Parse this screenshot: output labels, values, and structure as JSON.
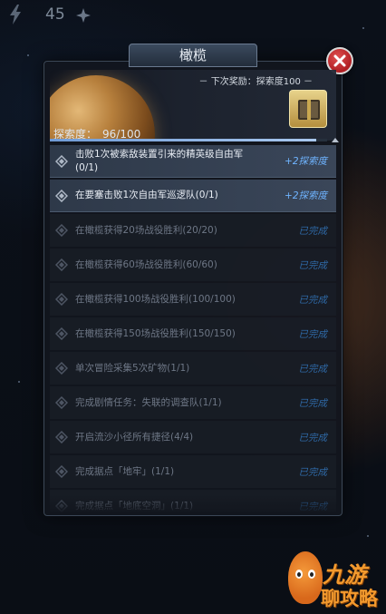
{
  "hud": {
    "count": "45"
  },
  "dialog": {
    "title": "橄榄",
    "reward_label": "－ 下次奖励：探索度100 －",
    "explore_label": "探索度：",
    "explore_value": "96/100",
    "explore_progress": 0.96
  },
  "tasks": [
    {
      "text": "击败1次被索敌装置引来的精英级自由军(0/1)",
      "status": "+2探索度",
      "state": "active"
    },
    {
      "text": "在要塞击败1次自由军巡逻队(0/1)",
      "status": "+2探索度",
      "state": "active"
    },
    {
      "text": "在橄榄获得20场战役胜利(20/20)",
      "status": "已完成",
      "state": "done"
    },
    {
      "text": "在橄榄获得60场战役胜利(60/60)",
      "status": "已完成",
      "state": "done"
    },
    {
      "text": "在橄榄获得100场战役胜利(100/100)",
      "status": "已完成",
      "state": "done"
    },
    {
      "text": "在橄榄获得150场战役胜利(150/150)",
      "status": "已完成",
      "state": "done"
    },
    {
      "text": "单次冒险采集5次矿物(1/1)",
      "status": "已完成",
      "state": "done"
    },
    {
      "text": "完成剧情任务：失联的调查队(1/1)",
      "status": "已完成",
      "state": "done"
    },
    {
      "text": "开启流沙小径所有捷径(4/4)",
      "status": "已完成",
      "state": "done"
    },
    {
      "text": "完成据点「地牢」(1/1)",
      "status": "已完成",
      "state": "done"
    },
    {
      "text": "完成据点「地底空洞」(1/1)",
      "status": "已完成",
      "state": "done"
    }
  ],
  "watermark": {
    "line1": "九游",
    "line2": "聊攻略"
  },
  "colors": {
    "accent_blue": "#6fb4ff",
    "close_red": "#c0282c",
    "done_gray": "#6d7685"
  }
}
